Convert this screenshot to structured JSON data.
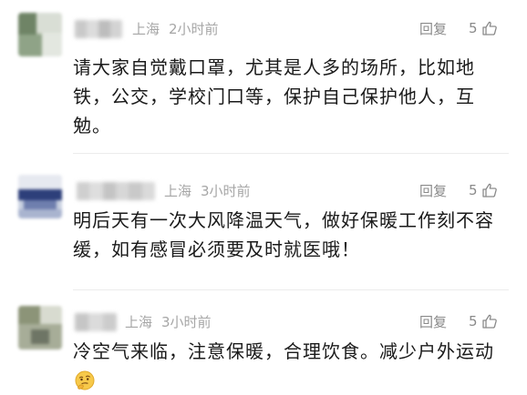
{
  "comments": [
    {
      "location": "上海",
      "time": "2小时前",
      "reply_label": "回复",
      "likes": "5",
      "text": "请大家自觉戴口罩，尤其是人多的场所，比如地铁，公交，学校门口等，保护自己保护他人，互勉。"
    },
    {
      "location": "上海",
      "time": "3小时前",
      "reply_label": "回复",
      "likes": "5",
      "text": "明后天有一次大风降温天气，做好保暖工作刻不容缓，如有感冒必须要及时就医哦！"
    },
    {
      "location": "上海",
      "time": "3小时前",
      "reply_label": "回复",
      "likes": "5",
      "text": "冷空气来临，注意保暖，合理饮食。减少户外运动",
      "emoji": "thinking-face-icon"
    }
  ],
  "colors": {
    "meta": "#a6a6a6",
    "action": "#8a8a8a",
    "text": "#1a1a1a"
  }
}
